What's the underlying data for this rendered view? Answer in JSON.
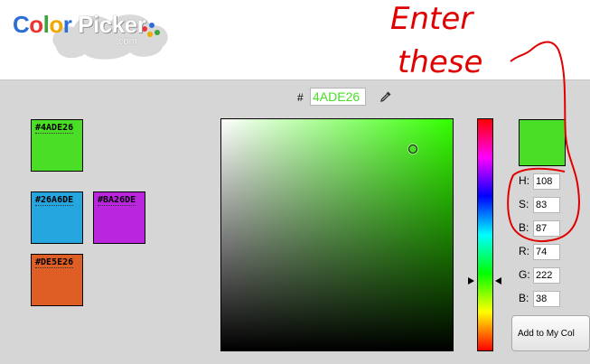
{
  "logo": {
    "text_color": "Color",
    "text_picker": "Picker",
    "dotcom": ".com"
  },
  "hex": {
    "hash": "#",
    "value": "4ADE26"
  },
  "icons": {
    "dropper": "eyedropper-icon"
  },
  "swatches": [
    {
      "label": "#4ADE26",
      "color": "#4ade26"
    },
    {
      "label": "#26A6DE",
      "color": "#26a6de"
    },
    {
      "label": "#BA26DE",
      "color": "#ba26de"
    },
    {
      "label": "#DE5E26",
      "color": "#de5e26"
    }
  ],
  "picker": {
    "hue": 108,
    "saturation": 83,
    "brightness": 87,
    "hue_color": "#33ff00",
    "preview_color": "#4ade26"
  },
  "fields": {
    "h_label": "H:",
    "h_value": "108",
    "s_label": "S:",
    "s_value": "83",
    "b_label": "B:",
    "b_value": "87",
    "r_label": "R:",
    "r_value": "74",
    "g_label": "G:",
    "g_value": "222",
    "b2_label": "B:",
    "b2_value": "38"
  },
  "add_button": "Add to My Col",
  "annotation": {
    "line1": "Enter",
    "line2": "these",
    "color": "#e00000"
  }
}
